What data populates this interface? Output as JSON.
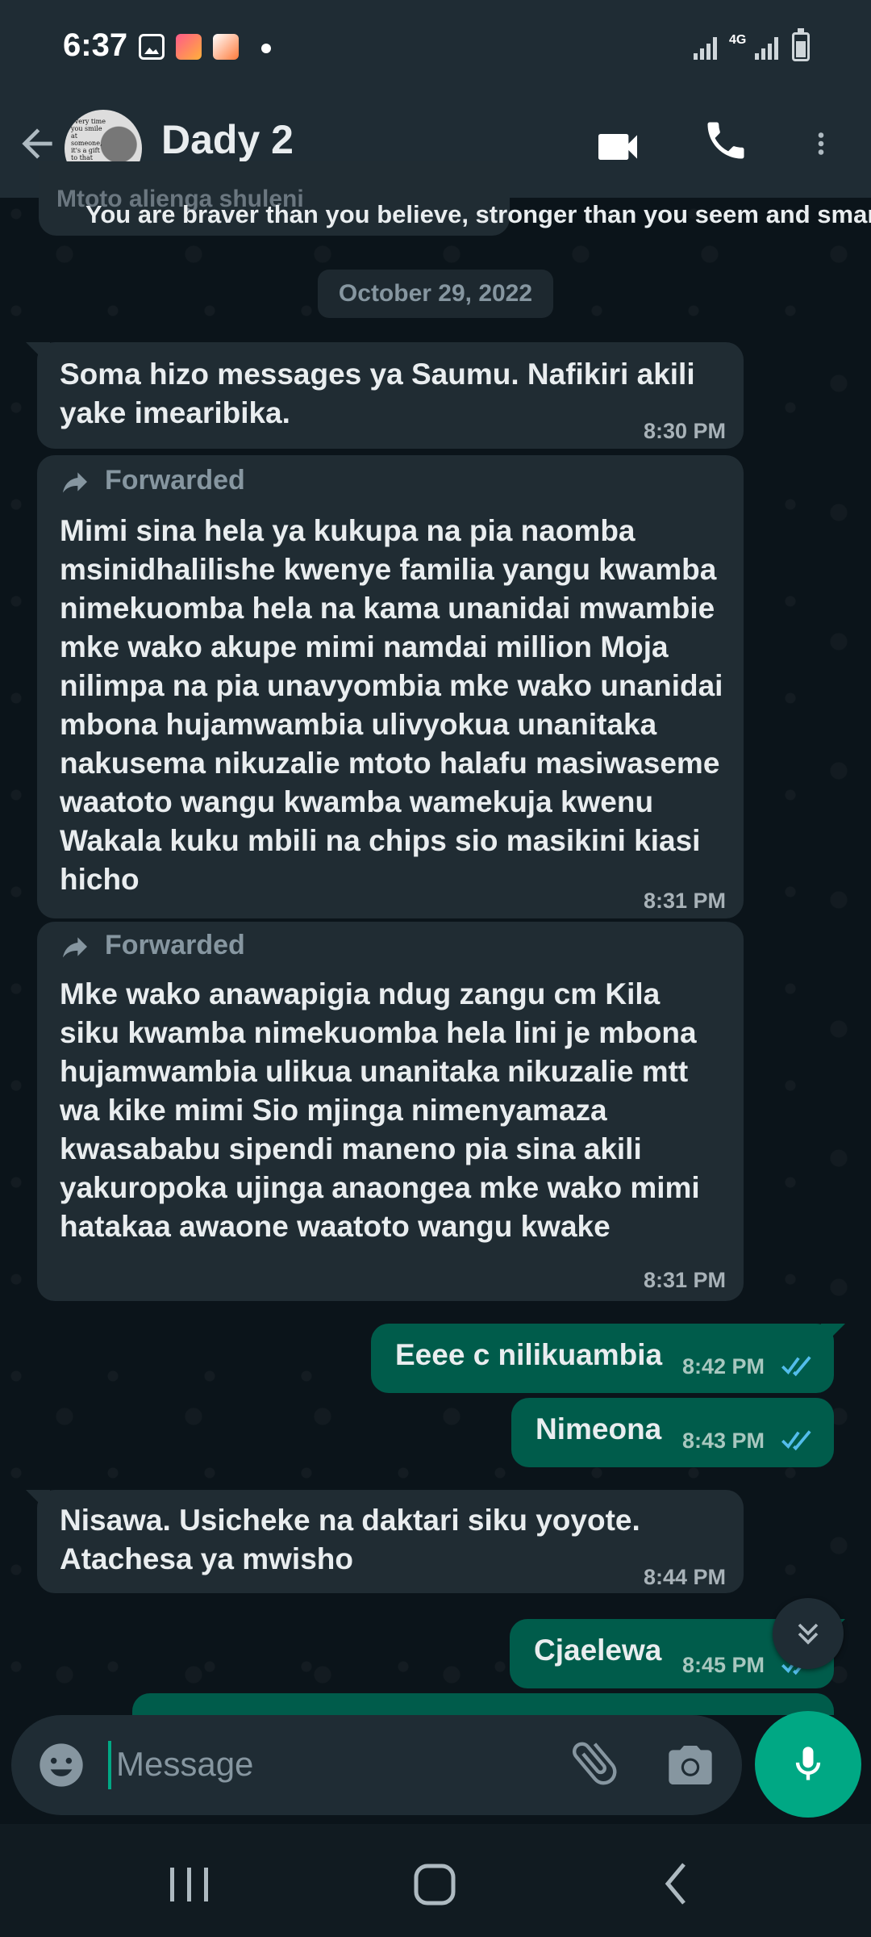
{
  "status_bar": {
    "time": "6:37",
    "network": "4G",
    "icons": [
      "image-icon",
      "app-icon-1",
      "app-icon-2",
      "dot-icon",
      "signal-icon",
      "battery-icon"
    ]
  },
  "header": {
    "contact_name": "Dady 2",
    "avatar_text": "every time you smile at someone, it's a gift to that person."
  },
  "chat": {
    "partial_old_text": "Mtoto alienga shuleni",
    "partial_quote": "You are braver than you believe, stronger than you seem and smar",
    "date_chip": "October 29, 2022",
    "messages": [
      {
        "direction": "incoming",
        "text": "Soma hizo messages ya Saumu. Nafikiri akili yake imearibika.",
        "time": "8:30 PM"
      },
      {
        "direction": "incoming",
        "forwarded": "Forwarded",
        "text": "Mimi sina hela ya kukupa na pia naomba msinidhalilishe kwenye familia yangu kwamba nimekuomba hela na kama unanidai mwambie mke wako akupe mimi namdai million Moja nilimpa na pia unavyombia mke wako unanidai mbona hujamwambia ulivyokua unanitaka nakusema nikuzalie mtoto halafu masiwaseme waatoto wangu kwamba wamekuja kwenu Wakala kuku mbili na chips sio masikini kiasi hicho",
        "time": "8:31 PM"
      },
      {
        "direction": "incoming",
        "forwarded": "Forwarded",
        "text": "Mke wako anawapigia ndug zangu cm Kila siku kwamba nimekuomba hela lini je mbona hujamwambia ulikua unanitaka nikuzalie mtt wa kike mimi Sio mjinga nimenyamaza kwasababu sipendi maneno pia sina akili yakuropoka ujinga anaongea mke wako mimi hatakaa awaone waatoto wangu kwake",
        "time": "8:31 PM"
      },
      {
        "direction": "outgoing",
        "text": "Eeee c nilikuambia",
        "time": "8:42 PM",
        "status": "read"
      },
      {
        "direction": "outgoing",
        "text": "Nimeona",
        "time": "8:43 PM",
        "status": "read"
      },
      {
        "direction": "incoming",
        "text": "Nisawa. Usicheke na daktari siku yoyote. Atachesa ya mwisho",
        "time": "8:44 PM"
      },
      {
        "direction": "outgoing",
        "text": "Cjaelewa",
        "time": "8:45 PM",
        "status": "read"
      }
    ]
  },
  "composer": {
    "placeholder": "Message"
  },
  "colors": {
    "header_bg": "#1f2c34",
    "chat_bg": "#0b141a",
    "incoming_bubble": "#202c33",
    "outgoing_bubble": "#005c4b",
    "accent": "#00a884",
    "read_ticks": "#53bdeb"
  }
}
